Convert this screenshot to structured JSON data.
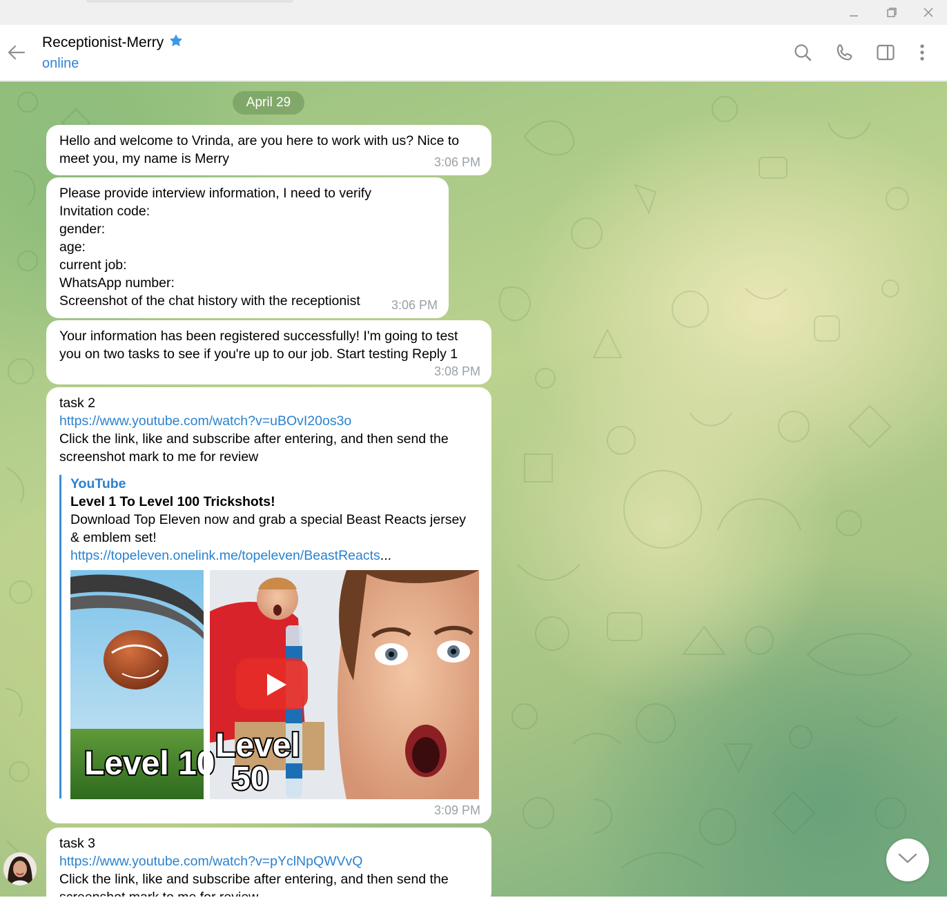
{
  "window": {
    "controls": {
      "minimize_icon": "minimize-icon",
      "restore_icon": "restore-icon",
      "close_icon": "close-icon"
    }
  },
  "header": {
    "title": "Receptionist-Merry",
    "status": "online",
    "verified_icon": "star-badge-icon",
    "actions": [
      "search-icon",
      "phone-icon",
      "sidebar-icon",
      "more-vertical-icon"
    ]
  },
  "date_separator": "April 29",
  "messages": [
    {
      "text": "Hello and welcome to Vrinda, are you here to work with us? Nice to meet you, my name is Merry",
      "time": "3:06 PM"
    },
    {
      "text": "Please provide interview information, I need to verify\nInvitation code:\ngender:\nage:\ncurrent job:\nWhatsApp number:\nScreenshot of the chat history with the receptionist",
      "time": "3:06 PM"
    },
    {
      "text": "Your information has been registered successfully! I'm going to test you on two tasks to see if you're up to our job. Start testing Reply 1",
      "time": "3:08 PM"
    },
    {
      "title_line": "task 2",
      "link": "https://www.youtube.com/watch?v=uBOvI20os3o",
      "text": "Click the link, like and subscribe after entering, and then send the screenshot mark to me for review",
      "preview": {
        "site": "YouTube",
        "title": "Level 1 To Level 100 Trickshots!",
        "description": "Download Top Eleven now and grab a special Beast Reacts jersey & emblem set!",
        "link": "https://topeleven.onelink.me/topeleven/BeastReacts",
        "ellipsis": "...",
        "thumbnail_labels": [
          "Level 10",
          "Level",
          "50"
        ],
        "play_icon": "youtube-play-icon"
      },
      "time": "3:09 PM"
    },
    {
      "title_line": "task 3",
      "link": "https://www.youtube.com/watch?v=pYclNpQWVvQ",
      "text": "Click the link, like and subscribe after entering, and then send the screenshot mark to me for review"
    }
  ],
  "scroll_button_icon": "chevron-down-icon",
  "colors": {
    "accent": "#2f85d6",
    "link": "#2a82cf",
    "time": "#9aa1a7",
    "date_pill": "#6e965a"
  }
}
